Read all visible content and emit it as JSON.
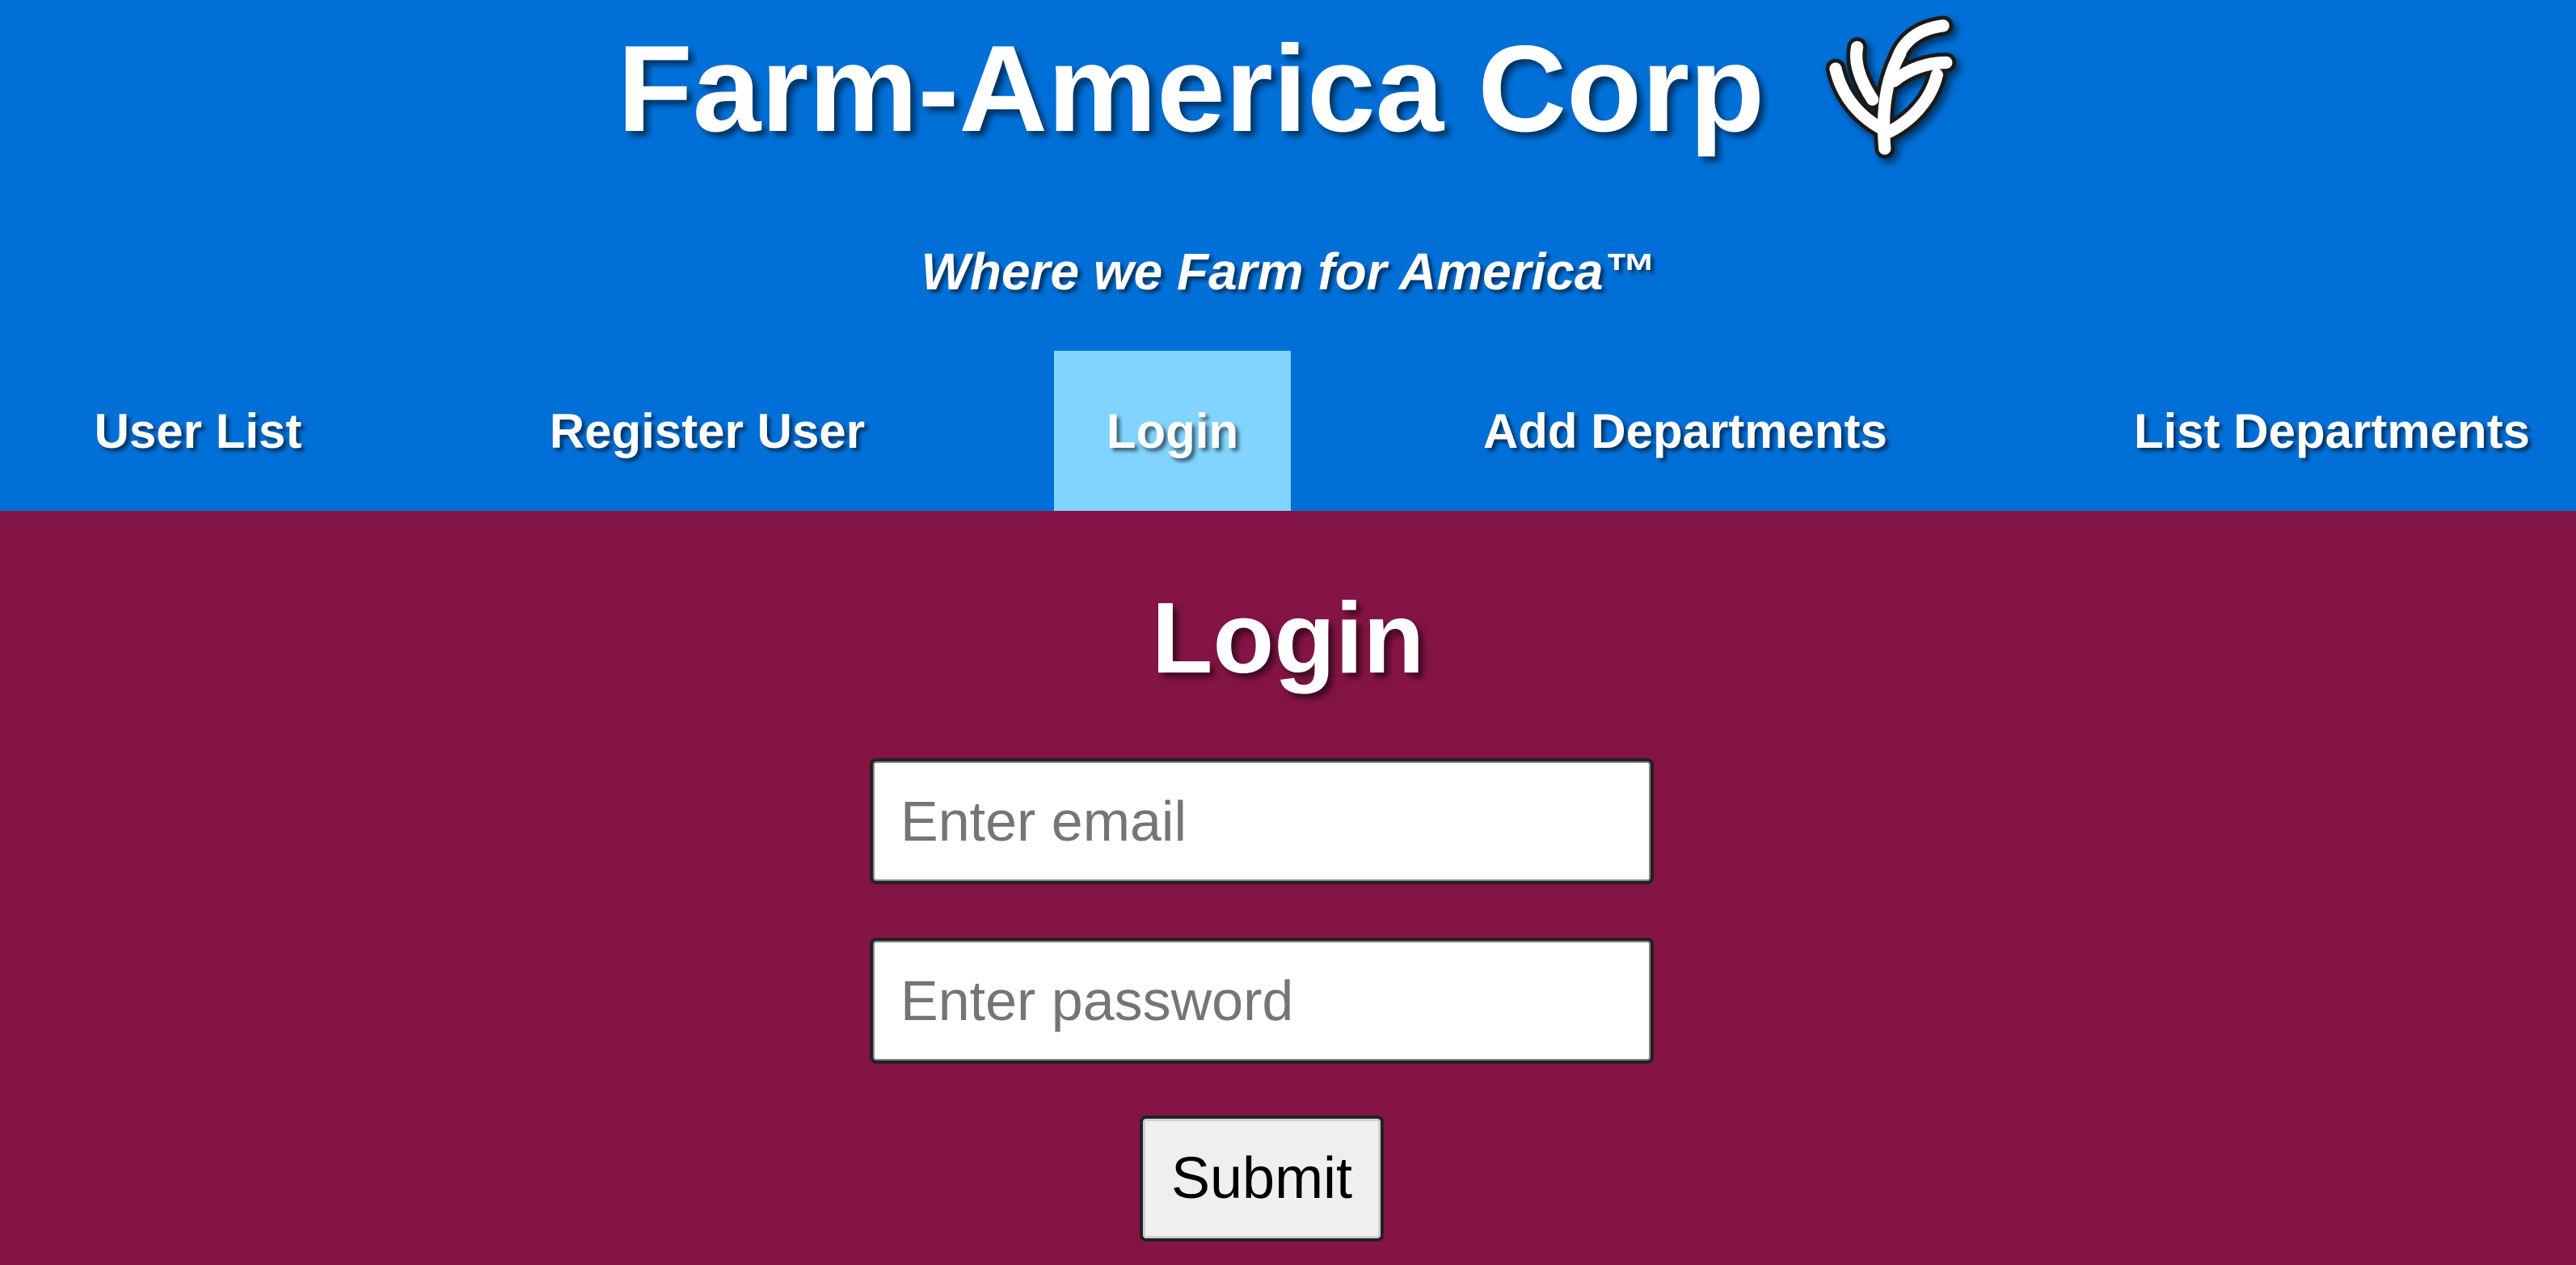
{
  "header": {
    "title": "Farm-America Corp",
    "tagline": "Where we Farm for America™",
    "logo_icon": "wheat-sprout-icon",
    "background_color": "#0070d8"
  },
  "nav": {
    "items": [
      {
        "label": "User List",
        "active": false
      },
      {
        "label": "Register User",
        "active": false
      },
      {
        "label": "Login",
        "active": true
      },
      {
        "label": "Add Departments",
        "active": false
      },
      {
        "label": "List Departments",
        "active": false
      }
    ],
    "active_color": "#80d4ff"
  },
  "main": {
    "heading": "Login",
    "background_color": "#851446",
    "email": {
      "value": "",
      "placeholder": "Enter email"
    },
    "password": {
      "value": "",
      "placeholder": "Enter password"
    },
    "submit_label": "Submit"
  }
}
